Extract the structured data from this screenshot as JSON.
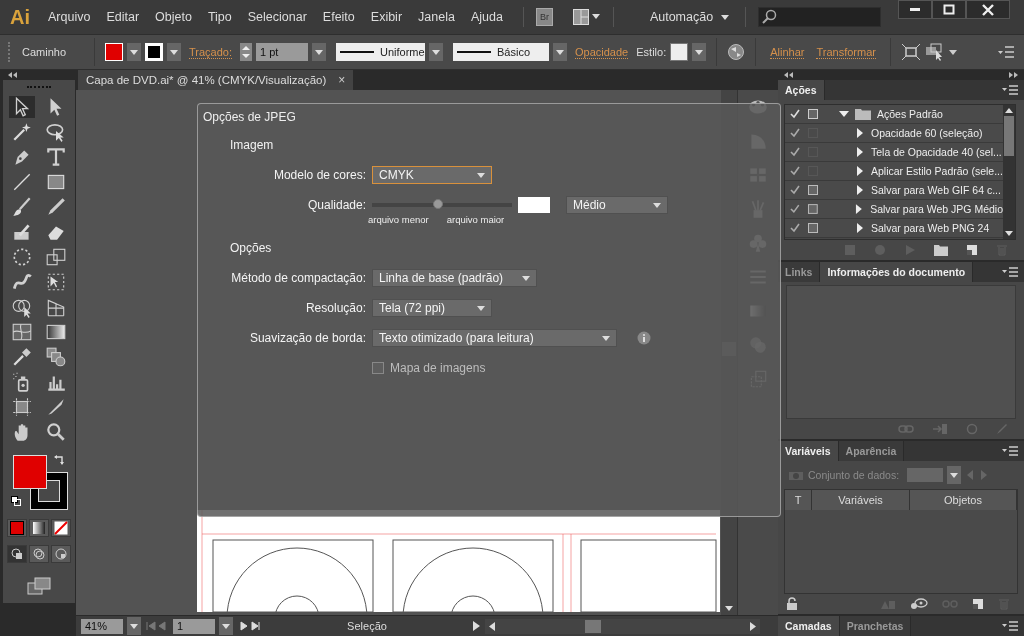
{
  "app": {
    "logo": "Ai",
    "menu": [
      "Arquivo",
      "Editar",
      "Objeto",
      "Tipo",
      "Selecionar",
      "Efeito",
      "Exibir",
      "Janela",
      "Ajuda"
    ],
    "bridge": "Br",
    "workspace": "Automação"
  },
  "control_bar": {
    "selection": "Caminho",
    "stroke_label": "Traçado:",
    "stroke_weight": "1 pt",
    "profile": "Uniforme",
    "brush": "Básico",
    "opacity_link": "Opacidade",
    "style_label": "Estilo:",
    "align_link": "Alinhar",
    "transform_link": "Transformar"
  },
  "document_tab": {
    "title": "Capa de DVD.ai* @ 41% (CMYK/Visualização)",
    "close": "×"
  },
  "toolbox": {
    "tools": [
      {
        "selected": true
      },
      {
        "selected": false
      },
      {
        "selected": false
      },
      {
        "selected": false
      },
      {
        "selected": false
      },
      {
        "selected": false
      },
      {
        "selected": false
      },
      {
        "selected": false
      },
      {
        "selected": false
      },
      {
        "selected": false
      },
      {
        "selected": false
      },
      {
        "selected": false
      },
      {
        "selected": false
      },
      {
        "selected": false
      },
      {
        "selected": false
      },
      {
        "selected": false
      },
      {
        "selected": false
      },
      {
        "selected": false
      },
      {
        "selected": false
      },
      {
        "selected": false
      },
      {
        "selected": false
      },
      {
        "selected": false
      },
      {
        "selected": false
      },
      {
        "selected": false
      },
      {
        "selected": false
      },
      {
        "selected": false
      },
      {
        "selected": false
      },
      {
        "selected": false
      }
    ]
  },
  "dialog": {
    "title": "Opções de JPEG",
    "image_section": {
      "heading": "Imagem",
      "color_model_label": "Modelo de cores:",
      "color_model": "CMYK",
      "quality_label": "Qualidade:",
      "quality": {
        "level": 0.47
      },
      "quality_preset": "Médio",
      "smaller_file": "arquivo menor",
      "larger_file": "arquivo maior"
    },
    "options_section": {
      "heading": "Opções",
      "compression_label": "Método de compactação:",
      "compression": "Linha de base (padrão)",
      "resolution_label": "Resolução:",
      "resolution": "Tela (72 ppi)",
      "antialias_label": "Suavização de borda:",
      "antialias": "Texto otimizado (para leitura)",
      "image_map": {
        "label": "Mapa de imagens",
        "checked": false,
        "disabled": true
      }
    }
  },
  "actions_panel": {
    "tabs": [
      {
        "label": "Ações",
        "selected": true
      }
    ],
    "actions": [
      {
        "label": "Ações Padrão",
        "kind": "set",
        "checked": true,
        "dialog": true,
        "expanded": true,
        "children": [
          {
            "label": "Opacidade 60 (seleção)",
            "kind": "action",
            "checked": true,
            "dialog": false,
            "expanded": false
          },
          {
            "label": "Tela de Opacidade 40 (sel...",
            "kind": "action",
            "checked": true,
            "dialog": false,
            "expanded": false
          },
          {
            "label": "Aplicar Estilo Padrão (sele...",
            "kind": "action",
            "checked": true,
            "dialog": false,
            "expanded": false
          },
          {
            "label": "Salvar para Web GIF 64 c...",
            "kind": "action",
            "checked": true,
            "dialog": true,
            "expanded": false
          },
          {
            "label": "Salvar para Web JPG Médio",
            "kind": "action",
            "checked": true,
            "dialog": true,
            "expanded": false
          },
          {
            "label": "Salvar para Web PNG 24",
            "kind": "action",
            "checked": true,
            "dialog": true,
            "expanded": false
          }
        ]
      }
    ]
  },
  "links_panel": {
    "tabs": [
      {
        "label": "Links",
        "selected": false
      },
      {
        "label": "Informações do documento",
        "selected": true
      }
    ]
  },
  "variables_panel": {
    "tabs": [
      {
        "label": "Variáveis",
        "selected": true
      },
      {
        "label": "Aparência",
        "selected": false
      }
    ],
    "dataset_label": "Conjunto de dados:",
    "columns": [
      "T",
      "Variáveis",
      "Objetos"
    ]
  },
  "layers_panel": {
    "tabs": [
      {
        "label": "Camadas",
        "selected": true
      },
      {
        "label": "Pranchetas",
        "selected": false
      }
    ]
  },
  "status_bar": {
    "zoom": "41%",
    "artboard": "1",
    "tool": "Seleção"
  }
}
